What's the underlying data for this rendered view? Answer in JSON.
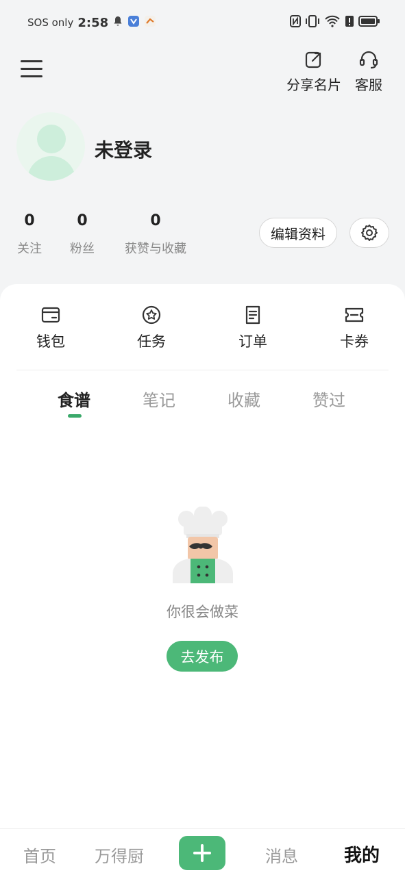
{
  "status_bar": {
    "carrier": "SOS only",
    "time": "2:58",
    "icons": [
      "bell-icon",
      "app-notification-icon",
      "app-notification-icon-2",
      "nfc-icon",
      "vibrate-icon",
      "wifi-icon",
      "alert-icon",
      "battery-icon"
    ]
  },
  "header": {
    "share_label": "分享名片",
    "service_label": "客服"
  },
  "profile": {
    "username": "未登录",
    "stats": [
      {
        "count": "0",
        "label": "关注"
      },
      {
        "count": "0",
        "label": "粉丝"
      },
      {
        "count": "0",
        "label": "获赞与收藏"
      }
    ],
    "edit_label": "编辑资料"
  },
  "quick_actions": [
    {
      "label": "钱包",
      "icon": "wallet-icon"
    },
    {
      "label": "任务",
      "icon": "star-circle-icon"
    },
    {
      "label": "订单",
      "icon": "order-icon"
    },
    {
      "label": "卡券",
      "icon": "ticket-icon"
    }
  ],
  "tabs": [
    {
      "label": "食谱",
      "active": true
    },
    {
      "label": "笔记",
      "active": false
    },
    {
      "label": "收藏",
      "active": false
    },
    {
      "label": "赞过",
      "active": false
    }
  ],
  "empty_state": {
    "message": "你很会做菜",
    "button_label": "去发布"
  },
  "bottom_nav": {
    "home": "首页",
    "brand": "万得厨",
    "messages": "消息",
    "mine": "我的",
    "active": "mine"
  },
  "colors": {
    "accent": "#4cb878",
    "background": "#f3f4f5"
  }
}
